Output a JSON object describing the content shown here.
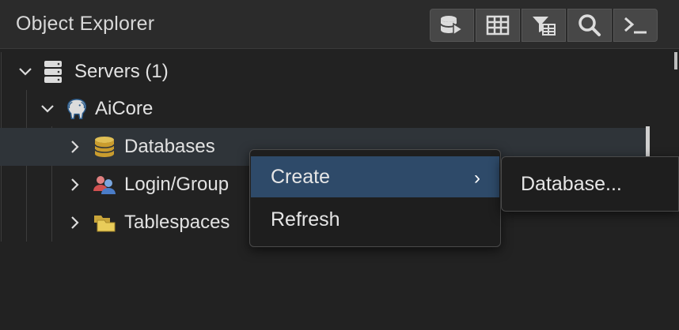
{
  "header": {
    "title": "Object Explorer",
    "toolbar": [
      {
        "icon": "query-tool-icon"
      },
      {
        "icon": "view-data-icon"
      },
      {
        "icon": "filtered-rows-icon"
      },
      {
        "icon": "search-objects-icon"
      },
      {
        "icon": "psql-tool-icon"
      }
    ]
  },
  "tree": {
    "servers": {
      "label": "Servers (1)"
    },
    "server": {
      "label": "AiCore"
    },
    "children": [
      {
        "label": "Databases"
      },
      {
        "label": "Login/Group"
      },
      {
        "label": "Tablespaces"
      }
    ]
  },
  "context_menu": {
    "items": [
      {
        "label": "Create",
        "arrow": "›"
      },
      {
        "label": "Refresh"
      }
    ],
    "submenu": {
      "items": [
        {
          "label": "Database..."
        }
      ]
    }
  },
  "colors": {
    "background": "#222222",
    "header": "#2b2b2b",
    "selection": "#2f3439",
    "menu_active": "#2e4a69",
    "database_icon": "#d9b44a"
  }
}
